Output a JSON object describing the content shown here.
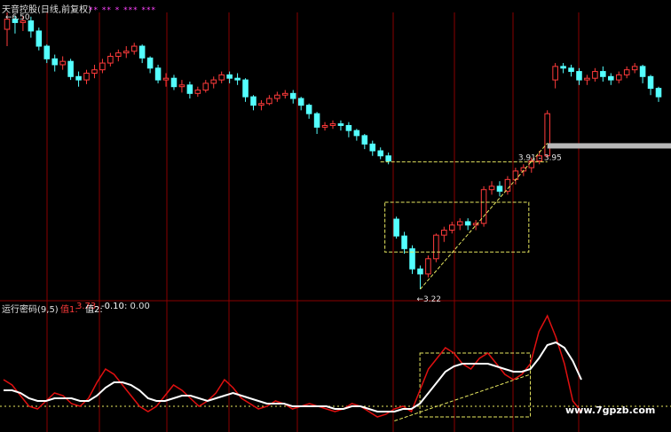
{
  "header": {
    "title": "天音控股(日线,前复权)",
    "stars": "**  **  *          ***          ***"
  },
  "price_chart": {
    "high_label": "6.50",
    "low_label": "3.22",
    "range_label": "3.91 - 3.95"
  },
  "indicator": {
    "name": "运行密码(9,5)",
    "v1_label": "值1:",
    "v1_value": "3.73",
    "v2_label": "值2:",
    "v2_value": "-0.10",
    "v3_value": ": 0.00"
  },
  "watermark": "www.7gpzb.com",
  "colors": {
    "background": "#000000",
    "up": "#ff3b3b",
    "down": "#54ffff",
    "signal_line": "#ffffff",
    "osc_line": "#e01010",
    "box": "#e8e860",
    "grid": "#8a0000",
    "header": "#e0e0e0",
    "stars": "#ff44ff"
  },
  "chart_data": {
    "type": "candlestick",
    "y_range": [
      3.22,
      6.5
    ],
    "candles": [
      [
        6.3,
        6.42,
        6.1,
        6.5
      ],
      [
        6.42,
        6.38,
        6.25,
        6.46
      ],
      [
        6.38,
        6.4,
        6.28,
        6.46
      ],
      [
        6.4,
        6.28,
        6.2,
        6.45
      ],
      [
        6.28,
        6.1,
        6.05,
        6.32
      ],
      [
        6.1,
        5.95,
        5.9,
        6.12
      ],
      [
        5.95,
        5.88,
        5.8,
        6.0
      ],
      [
        5.88,
        5.92,
        5.82,
        5.98
      ],
      [
        5.92,
        5.74,
        5.7,
        5.95
      ],
      [
        5.74,
        5.7,
        5.62,
        5.8
      ],
      [
        5.7,
        5.78,
        5.65,
        5.82
      ],
      [
        5.78,
        5.82,
        5.72,
        5.88
      ],
      [
        5.82,
        5.9,
        5.78,
        5.95
      ],
      [
        5.9,
        5.98,
        5.86,
        6.02
      ],
      [
        5.98,
        6.02,
        5.92,
        6.06
      ],
      [
        6.02,
        6.04,
        5.96,
        6.1
      ],
      [
        6.04,
        6.1,
        6.0,
        6.14
      ],
      [
        6.1,
        5.96,
        5.9,
        6.12
      ],
      [
        5.96,
        5.84,
        5.78,
        5.98
      ],
      [
        5.84,
        5.7,
        5.66,
        5.88
      ],
      [
        5.7,
        5.72,
        5.62,
        5.78
      ],
      [
        5.72,
        5.62,
        5.58,
        5.76
      ],
      [
        5.62,
        5.64,
        5.55,
        5.7
      ],
      [
        5.64,
        5.54,
        5.48,
        5.68
      ],
      [
        5.54,
        5.58,
        5.5,
        5.62
      ],
      [
        5.58,
        5.66,
        5.55,
        5.7
      ],
      [
        5.66,
        5.7,
        5.6,
        5.74
      ],
      [
        5.7,
        5.76,
        5.66,
        5.8
      ],
      [
        5.76,
        5.72,
        5.66,
        5.8
      ],
      [
        5.72,
        5.7,
        5.64,
        5.78
      ],
      [
        5.7,
        5.5,
        5.44,
        5.72
      ],
      [
        5.5,
        5.4,
        5.34,
        5.52
      ],
      [
        5.4,
        5.42,
        5.34,
        5.46
      ],
      [
        5.42,
        5.48,
        5.4,
        5.52
      ],
      [
        5.48,
        5.52,
        5.44,
        5.56
      ],
      [
        5.52,
        5.54,
        5.48,
        5.58
      ],
      [
        5.54,
        5.48,
        5.42,
        5.58
      ],
      [
        5.48,
        5.4,
        5.34,
        5.5
      ],
      [
        5.4,
        5.3,
        5.24,
        5.42
      ],
      [
        5.3,
        5.14,
        5.06,
        5.32
      ],
      [
        5.14,
        5.16,
        5.1,
        5.2
      ],
      [
        5.16,
        5.18,
        5.12,
        5.22
      ],
      [
        5.18,
        5.16,
        5.1,
        5.22
      ],
      [
        5.16,
        5.1,
        5.02,
        5.2
      ],
      [
        5.1,
        5.04,
        4.98,
        5.12
      ],
      [
        5.04,
        4.94,
        4.88,
        5.06
      ],
      [
        4.94,
        4.86,
        4.8,
        4.98
      ],
      [
        4.86,
        4.8,
        4.76,
        4.9
      ],
      [
        4.8,
        4.74,
        4.7,
        4.84
      ],
      [
        4.05,
        3.85,
        3.82,
        4.08
      ],
      [
        3.85,
        3.7,
        3.64,
        3.9
      ],
      [
        3.7,
        3.46,
        3.4,
        3.74
      ],
      [
        3.46,
        3.4,
        3.22,
        3.5
      ],
      [
        3.4,
        3.58,
        3.36,
        3.62
      ],
      [
        3.58,
        3.86,
        3.54,
        3.88
      ],
      [
        3.86,
        3.92,
        3.78,
        3.96
      ],
      [
        3.92,
        3.98,
        3.88,
        4.02
      ],
      [
        3.98,
        4.02,
        3.92,
        4.06
      ],
      [
        4.02,
        3.98,
        3.92,
        4.06
      ],
      [
        3.98,
        4.0,
        3.92,
        4.04
      ],
      [
        4.0,
        4.4,
        3.96,
        4.44
      ],
      [
        4.4,
        4.44,
        4.34,
        4.5
      ],
      [
        4.44,
        4.38,
        4.32,
        4.5
      ],
      [
        4.38,
        4.52,
        4.34,
        4.56
      ],
      [
        4.52,
        4.62,
        4.46,
        4.66
      ],
      [
        4.62,
        4.66,
        4.56,
        4.7
      ],
      [
        4.66,
        4.74,
        4.6,
        4.78
      ],
      [
        4.74,
        4.8,
        4.7,
        4.86
      ],
      [
        4.8,
        5.3,
        4.78,
        5.34
      ],
      [
        5.7,
        5.86,
        5.6,
        5.9
      ],
      [
        5.86,
        5.84,
        5.78,
        5.9
      ],
      [
        5.84,
        5.8,
        5.74,
        5.88
      ],
      [
        5.8,
        5.7,
        5.64,
        5.84
      ],
      [
        5.7,
        5.72,
        5.64,
        5.76
      ],
      [
        5.72,
        5.8,
        5.68,
        5.84
      ],
      [
        5.8,
        5.74,
        5.68,
        5.86
      ],
      [
        5.74,
        5.7,
        5.64,
        5.78
      ],
      [
        5.7,
        5.76,
        5.66,
        5.8
      ],
      [
        5.76,
        5.82,
        5.72,
        5.86
      ],
      [
        5.82,
        5.86,
        5.78,
        5.9
      ],
      [
        5.86,
        5.74,
        5.66,
        5.88
      ],
      [
        5.74,
        5.6,
        5.52,
        5.76
      ],
      [
        5.6,
        5.5,
        5.44,
        5.62
      ]
    ],
    "indicator_series": [
      {
        "values": [
          1.6,
          1.4,
          1.0,
          0.6,
          0.5,
          0.8,
          1.1,
          1.0,
          0.7,
          0.6,
          0.9,
          1.5,
          2.0,
          1.8,
          1.4,
          1.0,
          0.6,
          0.4,
          0.6,
          1.0,
          1.4,
          1.2,
          0.9,
          0.6,
          0.8,
          1.1,
          1.6,
          1.3,
          0.9,
          0.7,
          0.5,
          0.6,
          0.8,
          0.7,
          0.5,
          0.6,
          0.7,
          0.6,
          0.5,
          0.4,
          0.5,
          0.7,
          0.6,
          0.4,
          0.2,
          0.3,
          0.5,
          0.6,
          0.4,
          1.2,
          2.0,
          2.4,
          2.8,
          2.6,
          2.2,
          2.0,
          2.4,
          2.6,
          2.2,
          1.8,
          1.6,
          1.8,
          2.2,
          3.4,
          4.0,
          3.2,
          2.2,
          0.8,
          0.4
        ]
      },
      {
        "values": [
          1.2,
          1.2,
          1.1,
          0.9,
          0.8,
          0.8,
          0.9,
          0.9,
          0.9,
          0.8,
          0.8,
          1.0,
          1.3,
          1.5,
          1.5,
          1.4,
          1.2,
          0.9,
          0.8,
          0.8,
          0.9,
          1.0,
          1.0,
          0.9,
          0.8,
          0.9,
          1.0,
          1.1,
          1.0,
          0.9,
          0.8,
          0.7,
          0.7,
          0.7,
          0.6,
          0.6,
          0.6,
          0.6,
          0.6,
          0.5,
          0.5,
          0.6,
          0.6,
          0.5,
          0.4,
          0.4,
          0.4,
          0.5,
          0.5,
          0.7,
          1.1,
          1.5,
          1.9,
          2.1,
          2.2,
          2.2,
          2.2,
          2.2,
          2.1,
          2.0,
          1.9,
          1.9,
          2.0,
          2.4,
          2.9,
          3.0,
          2.8,
          2.3,
          1.6
        ]
      }
    ],
    "indicator_range": [
      -0.2,
      4.2
    ],
    "reference_lines": [
      0.6
    ]
  }
}
